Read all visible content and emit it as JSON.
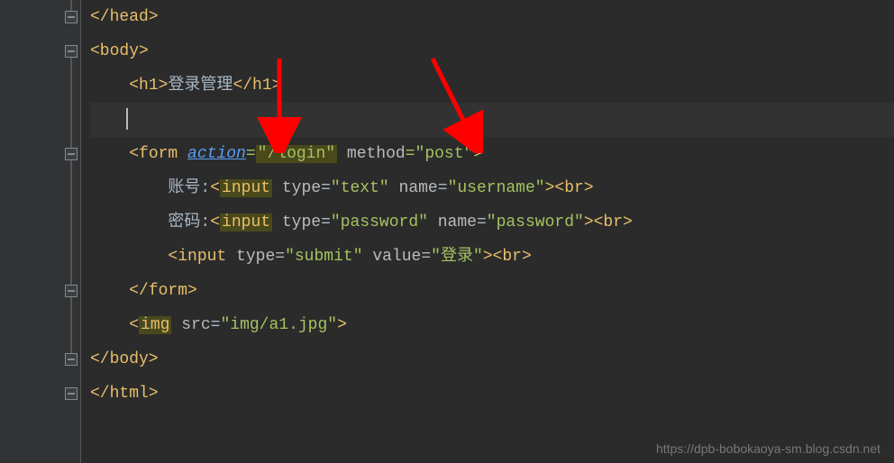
{
  "code": {
    "line1_head": "</head>",
    "line2_body_open": "<body>",
    "line3_h1_open": "<h1>",
    "line3_h1_text": "登录管理",
    "line3_h1_close": "</h1>",
    "line5_form_open_tag": "<form",
    "line5_action_attr": "action",
    "line5_action_eq": "=",
    "line5_action_val": "\"/login\"",
    "line5_method_attr": "method",
    "line5_method_eq": "=",
    "line5_method_val": "\"post\"",
    "line5_close": ">",
    "line6_label": "账号:",
    "line6_input": "<input",
    "line6_type_attr": "type",
    "line6_type_val": "\"text\"",
    "line6_name_attr": "name",
    "line6_name_val": "\"username\"",
    "line6_br": "><br>",
    "line7_label": "密码:",
    "line7_input": "<input",
    "line7_type_attr": "type",
    "line7_type_val": "\"password\"",
    "line7_name_attr": "name",
    "line7_name_val": "\"password\"",
    "line7_br": "><br>",
    "line8_input": "<input",
    "line8_type_attr": "type",
    "line8_type_val": "\"submit\"",
    "line8_value_attr": "value",
    "line8_value_val": "\"登录\"",
    "line8_br": "><br>",
    "line9_form_close": "</form>",
    "line10_img_open": "<img",
    "line10_src_attr": "src",
    "line10_src_val": "\"img/a1.jpg\"",
    "line10_close": ">",
    "line11_body_close": "</body>",
    "line12_html_close": "</html>"
  },
  "watermark": "https://dpb-bobokaoya-sm.blog.csdn.net"
}
